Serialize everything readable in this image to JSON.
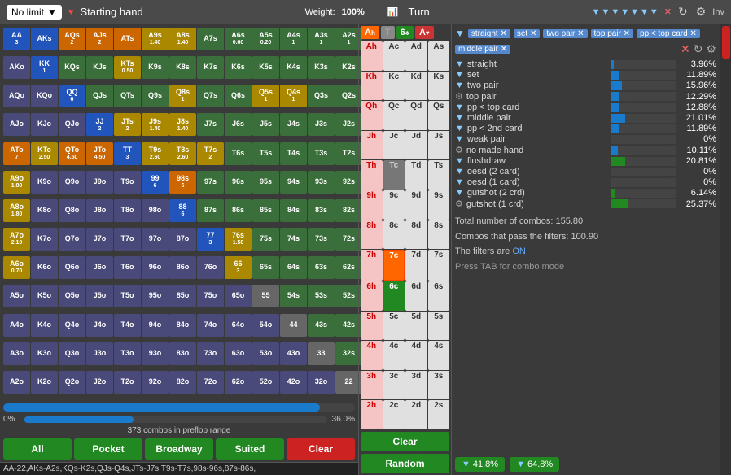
{
  "header": {
    "limit": "No limit",
    "starting_hand": "Starting hand",
    "weight_label": "Weight:",
    "weight_value": "100%",
    "turn_label": "Turn",
    "inv_label": "Inv"
  },
  "grid": {
    "rows": [
      [
        "AA\n3",
        "AKs\n",
        "AQs\n2",
        "AJs\n2",
        "ATs\n",
        "A9s\n1.40",
        "A8s\n1.40",
        "A7s\n",
        "A6s\n0.60",
        "A5s\n0.20",
        "A4s\n1",
        "A3s\n1",
        "A2s\n1"
      ],
      [
        "AKo\n",
        "KK\n1",
        "KQs\n",
        "KJs\n",
        "KTs\n0.50",
        "K9s\n",
        "K8s\n",
        "K7s\n",
        "K6s\n",
        "K5s\n",
        "K4s\n",
        "K3s\n",
        "K2s\n"
      ],
      [
        "AQo\n",
        "KQo\n",
        "QQ\n6",
        "QJs\n",
        "QTs\n",
        "Q9s\n",
        "Q8s\n1",
        "Q7s\n",
        "Q6s\n",
        "Q5s\n1",
        "Q4s\n1",
        "Q3s\n",
        "Q2s\n"
      ],
      [
        "AJo\n",
        "KJo\n",
        "QJo\n",
        "JJ\n2",
        "JTs\n2",
        "J9s\n1.40",
        "J8s\n1.40",
        "J7s\n",
        "J6s\n",
        "J5s\n",
        "J4s\n",
        "J3s\n",
        "J2s\n"
      ],
      [
        "ATo\n7",
        "KTo\n2.50",
        "QTo\n4.50",
        "JTo\n4.50",
        "TT\n3",
        "T9s\n2.60",
        "T8s\n2.60",
        "T7s\n2",
        "T6s\n",
        "T5s\n",
        "T4s\n",
        "T3s\n",
        "T2s\n"
      ],
      [
        "A9o\n1.80",
        "K9o\n",
        "Q9o\n",
        "J9o\n",
        "T9o\n",
        "99\n6",
        "98s\n6",
        "97s\n",
        "96s\n",
        "95s\n",
        "94s\n",
        "93s\n",
        "92s\n"
      ],
      [
        "A8o\n1.80",
        "K8o\n",
        "Q8o\n",
        "J8o\n",
        "T8o\n",
        "98o\n",
        "88\n6",
        "87s\n",
        "86s\n",
        "85s\n",
        "84s\n",
        "83s\n",
        "82s\n"
      ],
      [
        "A7o\n2.10",
        "K7o\n",
        "Q7o\n",
        "J7o\n",
        "T7o\n",
        "97o\n",
        "87o\n",
        "77\n3",
        "76s\n1.50",
        "75s\n",
        "74s\n",
        "73s\n",
        "72s\n"
      ],
      [
        "A6o\n0.70",
        "K6o\n",
        "Q6o\n",
        "J6o\n",
        "T6o\n",
        "96o\n",
        "86o\n",
        "76o\n",
        "66\n3",
        "65s\n",
        "64s\n",
        "63s\n",
        "62s\n"
      ],
      [
        "A5o\n",
        "K5o\n",
        "Q5o\n",
        "J5o\n",
        "T5o\n",
        "95o\n",
        "85o\n",
        "75o\n",
        "65o\n",
        "55\n",
        "54s\n",
        "53s\n",
        "52s\n"
      ],
      [
        "A4o\n",
        "K4o\n",
        "Q4o\n",
        "J4o\n",
        "T4o\n",
        "94o\n",
        "84o\n",
        "74o\n",
        "64o\n",
        "54o\n",
        "44\n",
        "43s\n",
        "42s\n"
      ],
      [
        "A3o\n",
        "K3o\n",
        "Q3o\n",
        "J3o\n",
        "T3o\n",
        "93o\n",
        "83o\n",
        "73o\n",
        "63o\n",
        "53o\n",
        "43o\n",
        "33\n",
        "32s\n"
      ],
      [
        "A2o\n",
        "K2o\n",
        "Q2o\n",
        "J2o\n",
        "T2o\n",
        "92o\n",
        "82o\n",
        "72o\n",
        "62o\n",
        "52o\n",
        "42o\n",
        "32o\n",
        "22\n"
      ]
    ],
    "combos_text": "373 combos in preflop range",
    "progress_pct": 36,
    "progress_label": "0%",
    "progress_value": "36.0%"
  },
  "buttons": {
    "all": "All",
    "pocket": "Pocket",
    "broadway": "Broadway",
    "suited": "Suited",
    "clear": "Clear"
  },
  "range_text": "AA-22,AKs-A2s,KQs-K2s,QJs-Q4s,JTs-J7s,T9s-T7s,98s-96s,87s-86s,",
  "turn": {
    "label": "Turn",
    "cards": [
      {
        "rank": "A",
        "suit": "h",
        "type": "red"
      },
      {
        "rank": "T",
        "suit": "",
        "type": "black"
      },
      {
        "rank": "A",
        "suit": "c",
        "type": "black"
      },
      {
        "rank": "A",
        "suit": "d",
        "type": "black"
      },
      {
        "rank": "A",
        "suit": "s",
        "type": "black"
      },
      {
        "rank": "K",
        "suit": "h",
        "type": "red"
      },
      {
        "rank": "K",
        "suit": "",
        "type": "black"
      },
      {
        "rank": "K",
        "suit": "d",
        "type": "black"
      },
      {
        "rank": "K",
        "suit": "s",
        "type": "black"
      },
      {
        "rank": "Q",
        "suit": "h",
        "type": "red"
      },
      {
        "rank": "Q",
        "suit": "",
        "type": "black"
      },
      {
        "rank": "Q",
        "suit": "d",
        "type": "black"
      },
      {
        "rank": "Q",
        "suit": "s",
        "type": "black"
      },
      {
        "rank": "J",
        "suit": "h",
        "type": "red"
      },
      {
        "rank": "J",
        "suit": "",
        "type": "black"
      },
      {
        "rank": "J",
        "suit": "d",
        "type": "black"
      },
      {
        "rank": "J",
        "suit": "s",
        "type": "black"
      },
      {
        "rank": "T",
        "suit": "h",
        "type": "red"
      },
      {
        "rank": "T",
        "suit": "",
        "type": "gray"
      },
      {
        "rank": "T",
        "suit": "d",
        "type": "black"
      },
      {
        "rank": "T",
        "suit": "s",
        "type": "black"
      },
      {
        "rank": "9",
        "suit": "h",
        "type": "red"
      },
      {
        "rank": "9",
        "suit": "",
        "type": "black"
      },
      {
        "rank": "9",
        "suit": "d",
        "type": "black"
      },
      {
        "rank": "9",
        "suit": "s",
        "type": "black"
      },
      {
        "rank": "8",
        "suit": "h",
        "type": "red"
      },
      {
        "rank": "8",
        "suit": "",
        "type": "black"
      },
      {
        "rank": "8",
        "suit": "d",
        "type": "black"
      },
      {
        "rank": "8",
        "suit": "s",
        "type": "black"
      },
      {
        "rank": "7",
        "suit": "h",
        "type": "red"
      },
      {
        "rank": "7",
        "suit": "c",
        "type": "active"
      },
      {
        "rank": "7",
        "suit": "d",
        "type": "black"
      },
      {
        "rank": "7",
        "suit": "s",
        "type": "black"
      },
      {
        "rank": "6",
        "suit": "h",
        "type": "red"
      },
      {
        "rank": "6",
        "suit": "c",
        "type": "active2"
      },
      {
        "rank": "6",
        "suit": "d",
        "type": "black"
      },
      {
        "rank": "6",
        "suit": "s",
        "type": "black"
      },
      {
        "rank": "5",
        "suit": "h",
        "type": "red"
      },
      {
        "rank": "5",
        "suit": "",
        "type": "black"
      },
      {
        "rank": "5",
        "suit": "d",
        "type": "black"
      },
      {
        "rank": "5",
        "suit": "s",
        "type": "black"
      },
      {
        "rank": "4",
        "suit": "h",
        "type": "red"
      },
      {
        "rank": "4",
        "suit": "",
        "type": "black"
      },
      {
        "rank": "4",
        "suit": "d",
        "type": "black"
      },
      {
        "rank": "4",
        "suit": "s",
        "type": "black"
      },
      {
        "rank": "3",
        "suit": "h",
        "type": "red"
      },
      {
        "rank": "3",
        "suit": "",
        "type": "black"
      },
      {
        "rank": "3",
        "suit": "d",
        "type": "black"
      },
      {
        "rank": "3",
        "suit": "s",
        "type": "black"
      },
      {
        "rank": "2",
        "suit": "h",
        "type": "red"
      },
      {
        "rank": "2",
        "suit": "",
        "type": "black"
      },
      {
        "rank": "2",
        "suit": "d",
        "type": "black"
      },
      {
        "rank": "2",
        "suit": "s",
        "type": "black"
      }
    ],
    "clear_btn": "Clear",
    "random_btn": "Random"
  },
  "filters": {
    "title_icons": "▼▼▼▼▼▼▼",
    "close_icon": "✕",
    "rows": [
      {
        "icon": "▼",
        "type": "funnel",
        "label": "straight",
        "bar_pct": 4,
        "value": "3.96%"
      },
      {
        "icon": "▼",
        "type": "funnel",
        "label": "set",
        "bar_pct": 12,
        "value": "11.89%"
      },
      {
        "icon": "▼",
        "type": "funnel",
        "label": "two pair",
        "bar_pct": 16,
        "value": "15.96%"
      },
      {
        "icon": "⚙",
        "type": "gear",
        "label": "top pair",
        "bar_pct": 13,
        "value": "12.29%"
      },
      {
        "icon": "▼",
        "type": "funnel",
        "label": "pp < top card",
        "bar_pct": 13,
        "value": "12.88%"
      },
      {
        "icon": "▼",
        "type": "funnel",
        "label": "middle pair",
        "bar_pct": 21,
        "value": "21.01%"
      },
      {
        "icon": "▼",
        "type": "funnel",
        "label": "pp < 2nd card",
        "bar_pct": 12,
        "value": "11.89%"
      },
      {
        "icon": "▼",
        "type": "funnel",
        "label": "weak pair",
        "bar_pct": 0,
        "value": "0%"
      },
      {
        "icon": "⚙",
        "type": "gear",
        "label": "no made hand",
        "bar_pct": 10,
        "value": "10.11%"
      },
      {
        "icon": "▼",
        "type": "funnel",
        "label": "flushdraw",
        "bar_pct": 20,
        "value": "20.81%"
      },
      {
        "icon": "▼",
        "type": "funnel",
        "label": "oesd (2 card)",
        "bar_pct": 0,
        "value": "0%"
      },
      {
        "icon": "▼",
        "type": "funnel",
        "label": "oesd (1 card)",
        "bar_pct": 0,
        "value": "0%"
      },
      {
        "icon": "▼",
        "type": "funnel",
        "label": "gutshot (2 crd)",
        "bar_pct": 6,
        "value": "6.14%"
      },
      {
        "icon": "⚙",
        "type": "gear",
        "label": "gutshot (1 crd)",
        "bar_pct": 25,
        "value": "25.37%"
      }
    ],
    "total_combos": "Total number of combos: 155.80",
    "filter_combos": "Combos that pass the filters: 100.90",
    "filters_status": "The filters are ",
    "filters_on": "ON",
    "tab_hint": "Press TAB for combo mode",
    "badge1_pct": "41.8%",
    "badge2_pct": "64.8%"
  }
}
